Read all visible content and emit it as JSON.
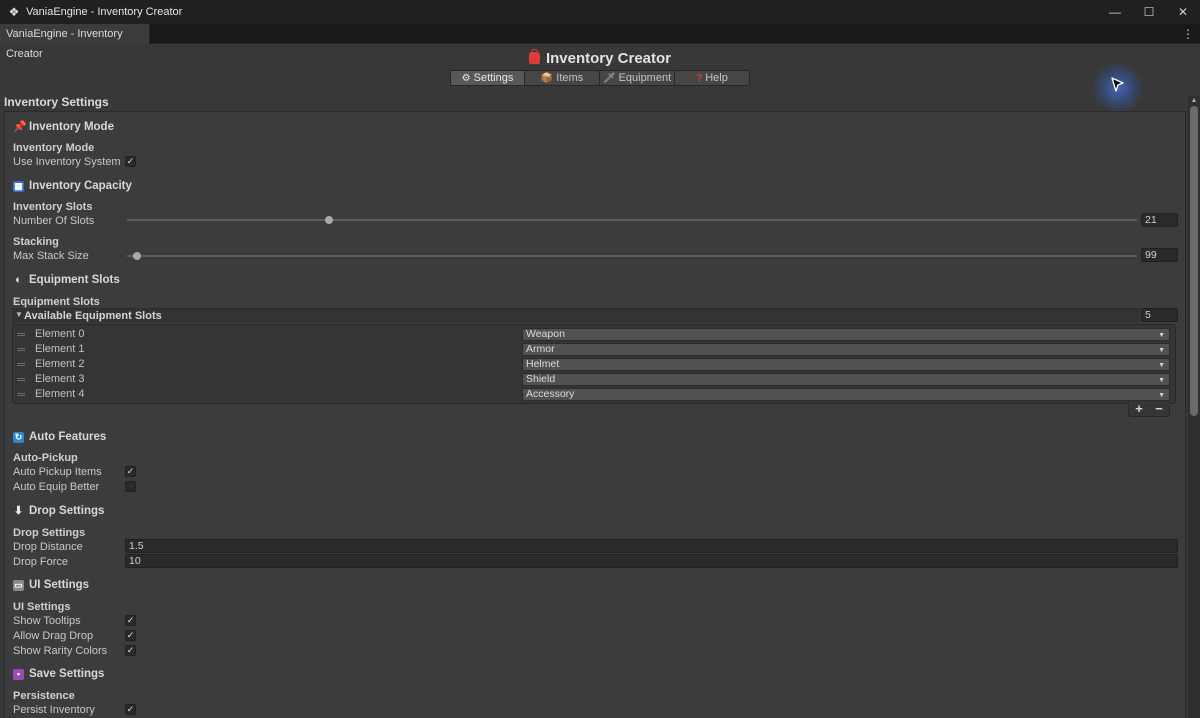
{
  "window": {
    "title": "VaniaEngine - Inventory Creator",
    "controls": [
      "—",
      "☐",
      "✕"
    ]
  },
  "doc_tab": {
    "label": "VaniaEngine - Inventory Creator",
    "menu": "⋮"
  },
  "header": {
    "title": "Inventory Creator",
    "tabs": [
      {
        "icon": "⚙",
        "label": "Settings"
      },
      {
        "icon": "📦",
        "label": "Items"
      },
      {
        "icon": "🗡",
        "label": "Equipment"
      },
      {
        "icon": "?",
        "label": "Help"
      }
    ]
  },
  "section_title": "Inventory Settings",
  "inventory_mode": {
    "title": "Inventory Mode",
    "subtitle": "Inventory Mode",
    "use_system_label": "Use Inventory System",
    "use_system_checked": true
  },
  "capacity": {
    "title": "Inventory Capacity",
    "slots_subtitle": "Inventory Slots",
    "num_slots_label": "Number Of Slots",
    "num_slots_value": "21",
    "num_slots_fraction": 0.2,
    "stacking_subtitle": "Stacking",
    "max_stack_label": "Max Stack Size",
    "max_stack_value": "99",
    "max_stack_fraction": 0.01
  },
  "equipment": {
    "title": "Equipment Slots",
    "subtitle": "Equipment Slots",
    "list_label": "Available Equipment Slots",
    "count": "5",
    "elements": [
      {
        "label": "Element 0",
        "value": "Weapon"
      },
      {
        "label": "Element 1",
        "value": "Armor"
      },
      {
        "label": "Element 2",
        "value": "Helmet"
      },
      {
        "label": "Element 3",
        "value": "Shield"
      },
      {
        "label": "Element 4",
        "value": "Accessory"
      }
    ],
    "add": "+",
    "remove": "−"
  },
  "auto": {
    "title": "Auto Features",
    "subtitle": "Auto-Pickup",
    "pickup_label": "Auto Pickup Items",
    "pickup_checked": true,
    "equip_label": "Auto Equip Better",
    "equip_checked": false
  },
  "drop": {
    "title": "Drop Settings",
    "subtitle": "Drop Settings",
    "distance_label": "Drop Distance",
    "distance_value": "1.5",
    "force_label": "Drop Force",
    "force_value": "10"
  },
  "ui": {
    "title": "UI Settings",
    "subtitle": "UI Settings",
    "tooltips_label": "Show Tooltips",
    "tooltips_checked": true,
    "drag_label": "Allow Drag Drop",
    "drag_checked": true,
    "rarity_label": "Show Rarity Colors",
    "rarity_checked": true
  },
  "save": {
    "title": "Save Settings",
    "subtitle": "Persistence",
    "persist_label": "Persist Inventory",
    "persist_checked": true
  },
  "colors": {
    "background": "#383838",
    "panel": "#3c3c3c",
    "titlebar": "#202020",
    "accent_red": "#e03a3a"
  }
}
